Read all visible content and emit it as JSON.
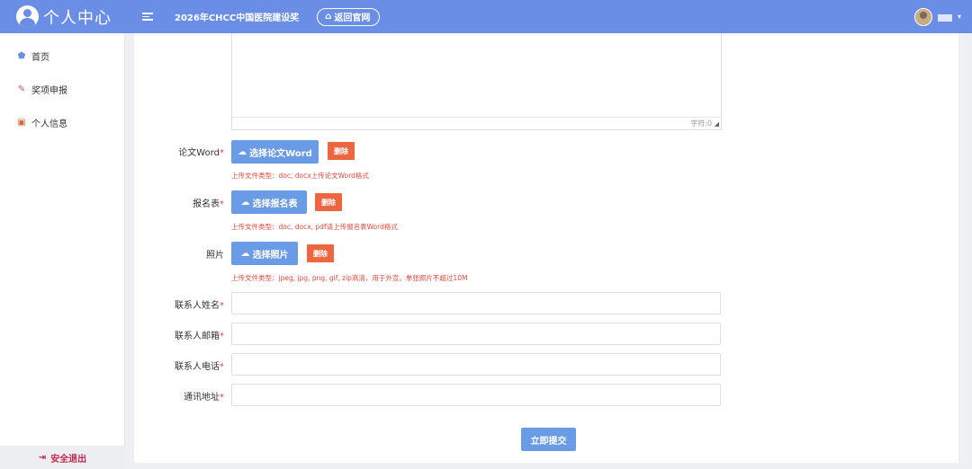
{
  "header": {
    "app_title": "个人中心",
    "site_title": "2026年CHCC中国医院建设奖",
    "home_button": "返回官网",
    "user_name": "",
    "colors": {
      "topbar": "#6a8ee6"
    }
  },
  "sidebar": {
    "items": [
      {
        "label": "首页",
        "icon": "home-icon"
      },
      {
        "label": "奖项申报",
        "icon": "award-icon"
      },
      {
        "label": "个人信息",
        "icon": "id-card-icon"
      }
    ],
    "logout": "安全退出"
  },
  "form": {
    "textarea_counter": "字符:0",
    "paper": {
      "label": "论文Word",
      "button": "选择论文Word",
      "delete": "删除",
      "hint": "上传文件类型：doc, docx上传论文Word格式"
    },
    "registration": {
      "label": "报名表",
      "button": "选择报名表",
      "delete": "删除",
      "hint": "上传文件类型：doc, docx, pdf请上传报名表Word格式"
    },
    "photo": {
      "label": "照片",
      "button": "选择照片",
      "delete": "删除",
      "hint": "上传文件类型：jpeg, jpg, png, gif, zip高清，用于外宣。单张照片不超过10M"
    },
    "contact_name": {
      "label": "联系人姓名",
      "value": ""
    },
    "contact_email": {
      "label": "联系人邮箱",
      "value": ""
    },
    "contact_phone": {
      "label": "联系人电话",
      "value": ""
    },
    "address": {
      "label": "通讯地址",
      "value": ""
    },
    "required_mark": "*",
    "submit": "立即提交"
  }
}
